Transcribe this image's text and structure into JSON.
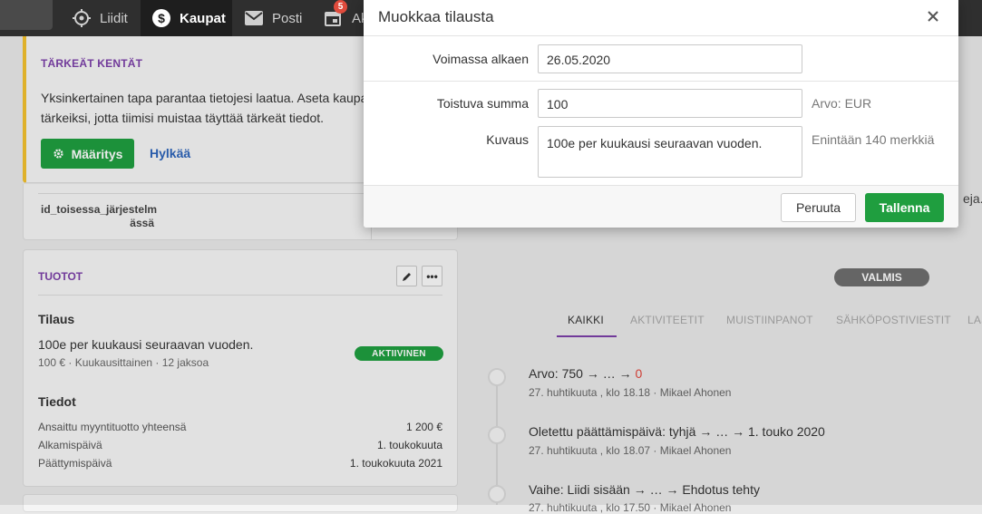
{
  "nav": {
    "items": [
      {
        "label": "Liidit",
        "icon": "target-icon"
      },
      {
        "label": "Kaupat",
        "icon": "dollar-icon"
      },
      {
        "label": "Posti",
        "icon": "mail-icon"
      },
      {
        "label": "Ak",
        "icon": "calendar-icon",
        "badge": "5"
      }
    ]
  },
  "important": {
    "title": "TÄRKEÄT KENTÄT",
    "text_line1": "Yksinkertainen tapa parantaa tietojesi laatua. Aseta kaupa",
    "text_line2": "tärkeiksi, jotta tiimisi muistaa täyttää tärkeät tiedot.",
    "setup_label": "Määritys",
    "dismiss_label": "Hylkää"
  },
  "idfield": {
    "line1": "id_toisessa_järjestelm",
    "line2": "ässä"
  },
  "products": {
    "title": "TUOTOT",
    "subscription_heading": "Tilaus",
    "subscription_name": "100e per kuukausi seuraavan vuoden.",
    "subscription_meta": "100 € · Kuukausittainen · 12 jaksoa",
    "status_badge": "AKTIIVINEN",
    "details_heading": "Tiedot",
    "details": [
      {
        "label": "Ansaittu myyntituotto yhteensä",
        "value": "1 200 €"
      },
      {
        "label": "Alkamispäivä",
        "value": "1. toukokuuta"
      },
      {
        "label": "Päättymispäivä",
        "value": "1. toukokuuta 2021"
      }
    ]
  },
  "right": {
    "partial_text": "eja.",
    "status_pill": "VALMIS",
    "tabs": [
      "KAIKKI",
      "AKTIVITEETIT",
      "MUISTIINPANOT",
      "SÄHKÖPOSTIVIESTIT",
      "LAS"
    ],
    "timeline": [
      {
        "title_prefix": "Arvo: 750 → … → ",
        "title_highlight": "0",
        "meta": "27. huhtikuuta , klo 18.18  ·  Mikael Ahonen"
      },
      {
        "title_prefix": "Oletettu päättämispäivä: tyhjä → … → 1. touko 2020",
        "title_highlight": "",
        "meta": "27. huhtikuuta , klo 18.07  ·  Mikael Ahonen"
      },
      {
        "title_prefix": "Vaihe: Liidi sisään → … → Ehdotus tehty",
        "title_highlight": "",
        "meta": "27. huhtikuuta , klo 17.50  ·  Mikael Ahonen"
      }
    ]
  },
  "modal": {
    "title": "Muokkaa tilausta",
    "start_label": "Voimassa alkaen",
    "start_value": "26.05.2020",
    "amount_label": "Toistuva summa",
    "amount_value": "100",
    "amount_hint": "Arvo: EUR",
    "desc_label": "Kuvaus",
    "desc_value": "100e per kuukausi seuraavan vuoden.",
    "desc_hint": "Enintään 140 merkkiä",
    "cancel_label": "Peruuta",
    "save_label": "Tallenna"
  },
  "colors": {
    "accent_green": "#1f9e3f",
    "accent_purple": "#7b3fa8",
    "nav_bg": "#2f2f2f",
    "link_blue": "#2c63b9",
    "badge_red": "#e04b3c"
  }
}
